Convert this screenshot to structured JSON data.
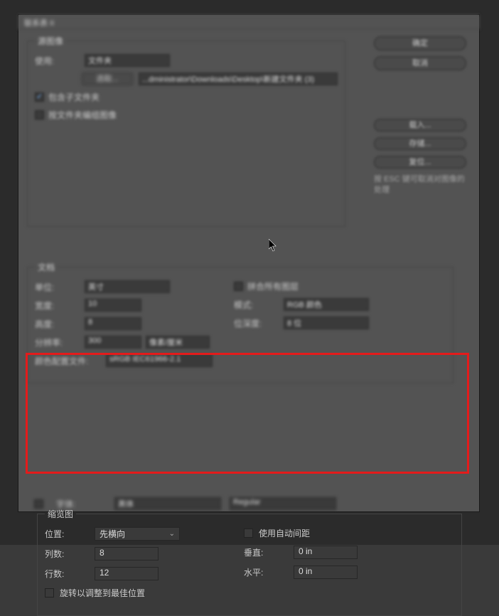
{
  "window": {
    "title": "联系表 II"
  },
  "actions": {
    "ok": "确定",
    "cancel": "取消",
    "load": "载入...",
    "save": "存储...",
    "reset": "复位...",
    "esc_hint": "按 ESC 键可取消对图像的处理"
  },
  "source": {
    "legend": "源图像",
    "use_label": "使用:",
    "use_value": "文件夹",
    "browse_btn": "选取...",
    "path": "...dministrator\\Downloads\\Desktop\\新建文件夹 (3)",
    "include_sub_label": "包含子文件夹",
    "include_sub_checked": true,
    "group_by_folder_label": "按文件夹编组图像",
    "group_by_folder_checked": false
  },
  "document": {
    "legend": "文档",
    "unit_label": "单位:",
    "unit_value": "英寸",
    "width_label": "宽度:",
    "width_value": "10",
    "height_label": "高度:",
    "height_value": "8",
    "res_label": "分辨率:",
    "res_value": "300",
    "res_unit": "像素/厘米",
    "flatten_label": "拼合所有图层",
    "flatten_checked": false,
    "mode_label": "模式:",
    "mode_value": "RGB 颜色",
    "bit_label": "位深度:",
    "bit_value": "8 位",
    "profile_label": "颜色配置文件:",
    "profile_value": "sRGB IEC61966-2.1"
  },
  "thumbnail": {
    "legend": "缩览图",
    "place_label": "位置:",
    "place_value": "先横向",
    "cols_label": "列数:",
    "cols_value": "8",
    "rows_label": "行数:",
    "rows_value": "12",
    "rotate_label": "旋转以调整到最佳位置",
    "rotate_checked": false,
    "auto_space_label": "使用自动间距",
    "auto_space_checked": false,
    "vert_label": "垂直:",
    "vert_value": "0 in",
    "horz_label": "水平:",
    "horz_value": "0 in"
  },
  "caption": {
    "font_label": "字体:",
    "font_value": "黑体",
    "style_value": "Regular"
  }
}
